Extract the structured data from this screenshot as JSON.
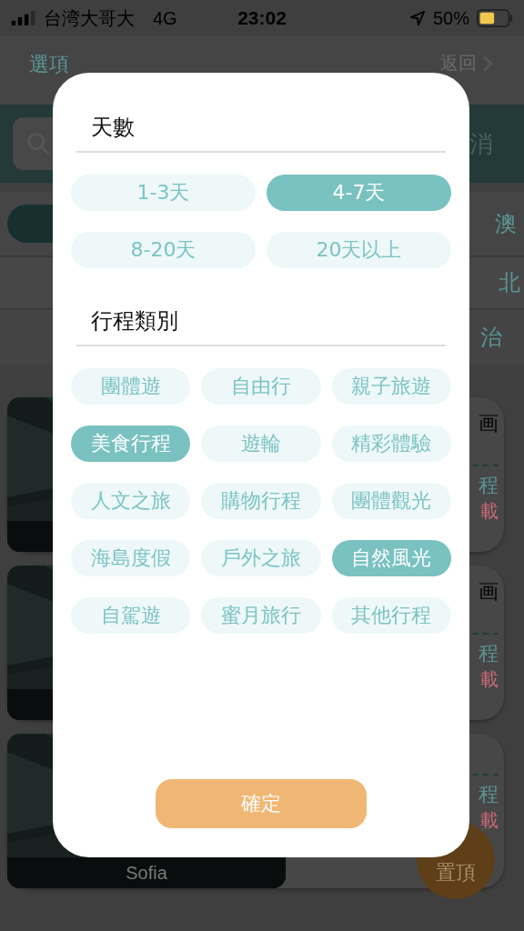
{
  "status_bar": {
    "carrier": "台湾大哥大",
    "network": "4G",
    "time": "23:02",
    "battery": "50%"
  },
  "nav": {
    "left": "選項",
    "right": "返回"
  },
  "search": {
    "cancel": "消"
  },
  "filters": {
    "tab_right": "澳",
    "row_right": "北",
    "row2_right": "治"
  },
  "cards": [
    {
      "title": "画",
      "line": "程",
      "download": "載"
    },
    {
      "title": "画",
      "line": "程",
      "download": "載"
    },
    {
      "caption": "Sofia",
      "line": "程",
      "download": "載"
    }
  ],
  "fab": "置頂",
  "modal": {
    "sections": [
      {
        "title": "天數",
        "kind": "days",
        "options": [
          {
            "label": "1-3天",
            "selected": false
          },
          {
            "label": "4-7天",
            "selected": true
          },
          {
            "label": "8-20天",
            "selected": false
          },
          {
            "label": "20天以上",
            "selected": false
          }
        ]
      },
      {
        "title": "行程類別",
        "kind": "types",
        "options": [
          {
            "label": "團體遊",
            "selected": false
          },
          {
            "label": "自由行",
            "selected": false
          },
          {
            "label": "親子旅遊",
            "selected": false
          },
          {
            "label": "美食行程",
            "selected": true
          },
          {
            "label": "遊輪",
            "selected": false
          },
          {
            "label": "精彩體驗",
            "selected": false
          },
          {
            "label": "人文之旅",
            "selected": false
          },
          {
            "label": "購物行程",
            "selected": false
          },
          {
            "label": "團體觀光",
            "selected": false
          },
          {
            "label": "海島度假",
            "selected": false
          },
          {
            "label": "戶外之旅",
            "selected": false
          },
          {
            "label": "自然風光",
            "selected": true
          },
          {
            "label": "自駕遊",
            "selected": false
          },
          {
            "label": "蜜月旅行",
            "selected": false
          },
          {
            "label": "其他行程",
            "selected": false
          }
        ]
      }
    ],
    "confirm": "確定"
  }
}
